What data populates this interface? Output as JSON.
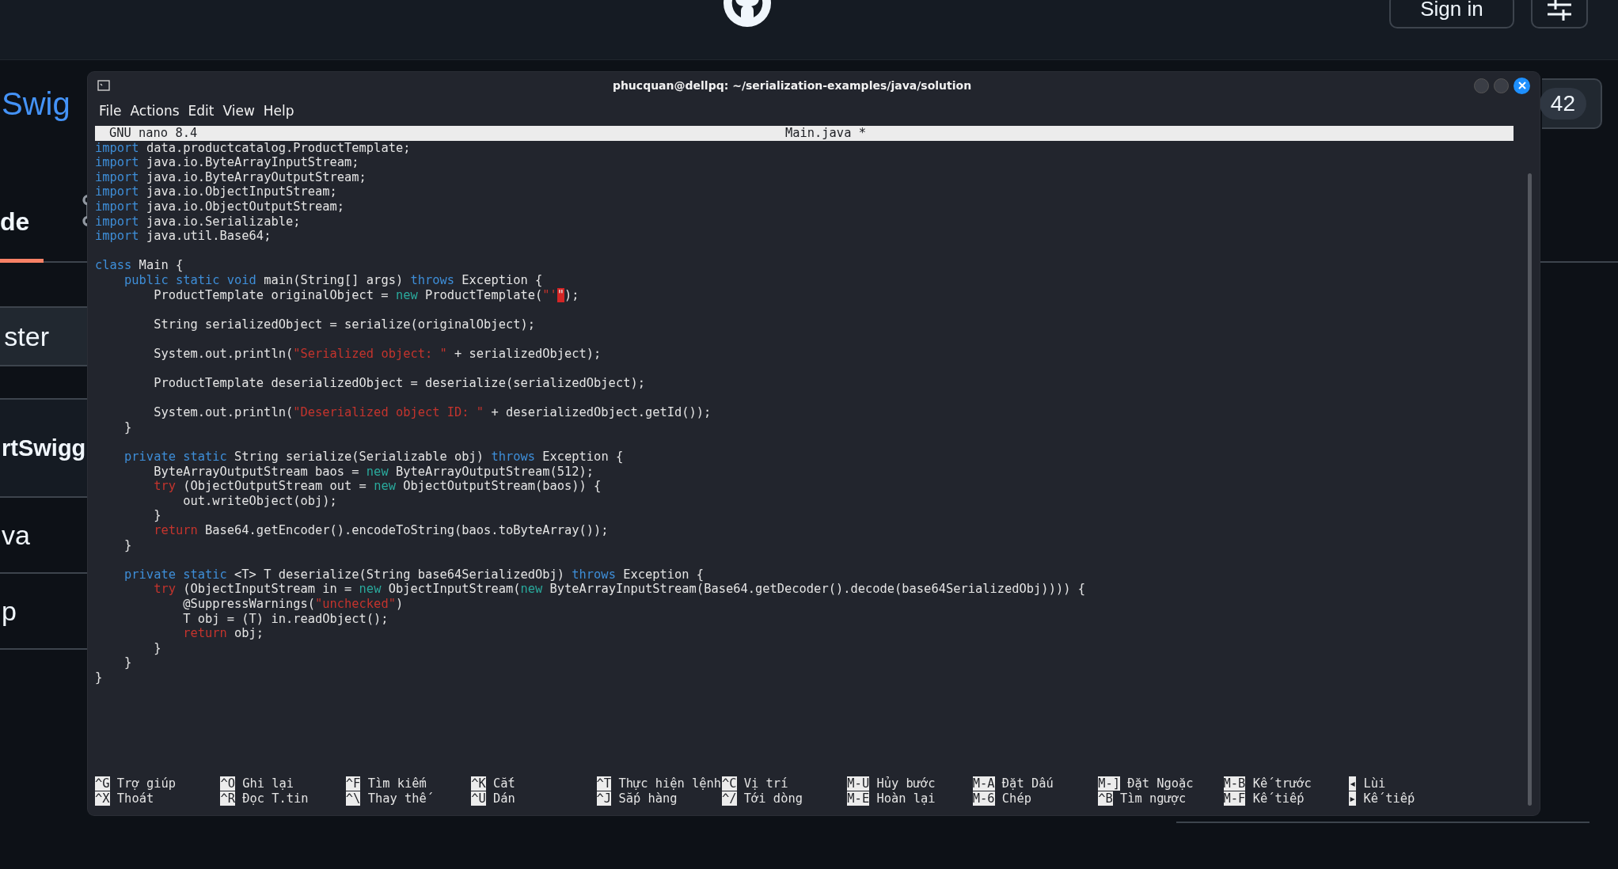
{
  "github": {
    "header": {
      "sign_in": "Sign in"
    },
    "repo": {
      "title": "Swig",
      "star_count": "42"
    },
    "tabs": [
      {
        "label": "de",
        "selected": true
      }
    ],
    "branch": "ster",
    "commit": {
      "author": "rtSwigg"
    },
    "files": [
      {
        "name": "va"
      },
      {
        "name": "p"
      }
    ]
  },
  "terminal": {
    "title": "phucquan@dellpq: ~/serialization-examples/java/solution",
    "menu": [
      "File",
      "Actions",
      "Edit",
      "View",
      "Help"
    ],
    "nano": {
      "version": "GNU nano 8.4",
      "filename": "Main.java *",
      "lines": [
        {
          "kind": "code",
          "segments": [
            {
              "kind": "keyword",
              "text": "import"
            },
            {
              "kind": "plain",
              "text": " data.productcatalog.ProductTemplate;"
            }
          ]
        },
        {
          "kind": "code",
          "segments": [
            {
              "kind": "keyword",
              "text": "import"
            },
            {
              "kind": "plain",
              "text": " java.io.ByteArrayInputStream;"
            }
          ]
        },
        {
          "kind": "code",
          "segments": [
            {
              "kind": "keyword",
              "text": "import"
            },
            {
              "kind": "plain",
              "text": " java.io.ByteArrayOutputStream;"
            }
          ]
        },
        {
          "kind": "code",
          "segments": [
            {
              "kind": "keyword",
              "text": "import"
            },
            {
              "kind": "plain",
              "text": " java.io.ObjectInputStream;"
            }
          ]
        },
        {
          "kind": "code",
          "segments": [
            {
              "kind": "keyword",
              "text": "import"
            },
            {
              "kind": "plain",
              "text": " java.io.ObjectOutputStream;"
            }
          ]
        },
        {
          "kind": "code",
          "segments": [
            {
              "kind": "keyword",
              "text": "import"
            },
            {
              "kind": "plain",
              "text": " java.io.Serializable;"
            }
          ]
        },
        {
          "kind": "code",
          "segments": [
            {
              "kind": "keyword",
              "text": "import"
            },
            {
              "kind": "plain",
              "text": " java.util.Base64;"
            }
          ]
        },
        {
          "kind": "blank"
        },
        {
          "kind": "code",
          "segments": [
            {
              "kind": "keyword",
              "text": "class"
            },
            {
              "kind": "plain",
              "text": " Main {"
            }
          ]
        },
        {
          "kind": "code",
          "segments": [
            {
              "kind": "keyword",
              "text": "    public static void"
            },
            {
              "kind": "plain",
              "text": " main(String[] args) "
            },
            {
              "kind": "keyword",
              "text": "throws"
            },
            {
              "kind": "plain",
              "text": " Exception {"
            }
          ]
        },
        {
          "kind": "code",
          "segments": [
            {
              "kind": "plain",
              "text": "        ProductTemplate originalObject = "
            },
            {
              "kind": "new",
              "text": "new"
            },
            {
              "kind": "plain",
              "text": " ProductTemplate("
            },
            {
              "kind": "string",
              "text": "\"'"
            },
            {
              "kind": "cursor",
              "text": "\""
            },
            {
              "kind": "plain",
              "text": ");"
            }
          ]
        },
        {
          "kind": "blank"
        },
        {
          "kind": "code",
          "segments": [
            {
              "kind": "plain",
              "text": "        String serializedObject = serialize(originalObject);"
            }
          ]
        },
        {
          "kind": "blank"
        },
        {
          "kind": "code",
          "segments": [
            {
              "kind": "plain",
              "text": "        System.out.println("
            },
            {
              "kind": "string",
              "text": "\"Serialized object: \""
            },
            {
              "kind": "plain",
              "text": " + serializedObject);"
            }
          ]
        },
        {
          "kind": "blank"
        },
        {
          "kind": "code",
          "segments": [
            {
              "kind": "plain",
              "text": "        ProductTemplate deserializedObject = deserialize(serializedObject);"
            }
          ]
        },
        {
          "kind": "blank"
        },
        {
          "kind": "code",
          "segments": [
            {
              "kind": "plain",
              "text": "        System.out.println("
            },
            {
              "kind": "string",
              "text": "\"Deserialized object ID: \""
            },
            {
              "kind": "plain",
              "text": " + deserializedObject.getId());"
            }
          ]
        },
        {
          "kind": "code",
          "segments": [
            {
              "kind": "plain",
              "text": "    }"
            }
          ]
        },
        {
          "kind": "blank"
        },
        {
          "kind": "code",
          "segments": [
            {
              "kind": "keyword",
              "text": "    private static"
            },
            {
              "kind": "plain",
              "text": " String serialize(Serializable obj) "
            },
            {
              "kind": "keyword",
              "text": "throws"
            },
            {
              "kind": "plain",
              "text": " Exception {"
            }
          ]
        },
        {
          "kind": "code",
          "segments": [
            {
              "kind": "plain",
              "text": "        ByteArrayOutputStream baos = "
            },
            {
              "kind": "new",
              "text": "new"
            },
            {
              "kind": "plain",
              "text": " ByteArrayOutputStream(512);"
            }
          ]
        },
        {
          "kind": "code",
          "segments": [
            {
              "kind": "control",
              "text": "        try"
            },
            {
              "kind": "plain",
              "text": " (ObjectOutputStream out = "
            },
            {
              "kind": "new",
              "text": "new"
            },
            {
              "kind": "plain",
              "text": " ObjectOutputStream(baos)) {"
            }
          ]
        },
        {
          "kind": "code",
          "segments": [
            {
              "kind": "plain",
              "text": "            out.writeObject(obj);"
            }
          ]
        },
        {
          "kind": "code",
          "segments": [
            {
              "kind": "plain",
              "text": "        }"
            }
          ]
        },
        {
          "kind": "code",
          "segments": [
            {
              "kind": "control",
              "text": "        return"
            },
            {
              "kind": "plain",
              "text": " Base64.getEncoder().encodeToString(baos.toByteArray());"
            }
          ]
        },
        {
          "kind": "code",
          "segments": [
            {
              "kind": "plain",
              "text": "    }"
            }
          ]
        },
        {
          "kind": "blank"
        },
        {
          "kind": "code",
          "segments": [
            {
              "kind": "keyword",
              "text": "    private static"
            },
            {
              "kind": "plain",
              "text": " <T> T deserialize(String base64SerializedObj) "
            },
            {
              "kind": "keyword",
              "text": "throws"
            },
            {
              "kind": "plain",
              "text": " Exception {"
            }
          ]
        },
        {
          "kind": "code",
          "segments": [
            {
              "kind": "control",
              "text": "        try"
            },
            {
              "kind": "plain",
              "text": " (ObjectInputStream in = "
            },
            {
              "kind": "new",
              "text": "new"
            },
            {
              "kind": "plain",
              "text": " ObjectInputStream("
            },
            {
              "kind": "new",
              "text": "new"
            },
            {
              "kind": "plain",
              "text": " ByteArrayInputStream(Base64.getDecoder().decode(base64SerializedObj)))) {"
            }
          ]
        },
        {
          "kind": "code",
          "segments": [
            {
              "kind": "plain",
              "text": "            @SuppressWarnings("
            },
            {
              "kind": "string",
              "text": "\"unchecked\""
            },
            {
              "kind": "plain",
              "text": ")"
            }
          ]
        },
        {
          "kind": "code",
          "segments": [
            {
              "kind": "plain",
              "text": "            T obj = (T) in.readObject();"
            }
          ]
        },
        {
          "kind": "code",
          "segments": [
            {
              "kind": "control",
              "text": "            return"
            },
            {
              "kind": "plain",
              "text": " obj;"
            }
          ]
        },
        {
          "kind": "code",
          "segments": [
            {
              "kind": "plain",
              "text": "        }"
            }
          ]
        },
        {
          "kind": "code",
          "segments": [
            {
              "kind": "plain",
              "text": "    }"
            }
          ]
        },
        {
          "kind": "code",
          "segments": [
            {
              "kind": "plain",
              "text": "}"
            }
          ]
        }
      ],
      "shortcuts": [
        [
          {
            "key": "^G",
            "label": "Trợ giúp"
          },
          {
            "key": "^X",
            "label": "Thoát"
          }
        ],
        [
          {
            "key": "^O",
            "label": "Ghi lại"
          },
          {
            "key": "^R",
            "label": "Đọc T.tin"
          }
        ],
        [
          {
            "key": "^F",
            "label": "Tìm kiếm"
          },
          {
            "key": "^\\",
            "label": "Thay thế"
          }
        ],
        [
          {
            "key": "^K",
            "label": "Cắt"
          },
          {
            "key": "^U",
            "label": "Dán"
          }
        ],
        [
          {
            "key": "^T",
            "label": "Thực hiện lệnh"
          },
          {
            "key": "^J",
            "label": "Sắp hàng"
          }
        ],
        [
          {
            "key": "^C",
            "label": "Vị trí"
          },
          {
            "key": "^/",
            "label": "Tới dòng"
          }
        ],
        [
          {
            "key": "M-U",
            "label": "Hủy bước"
          },
          {
            "key": "M-E",
            "label": "Hoàn lại"
          }
        ],
        [
          {
            "key": "M-A",
            "label": "Đặt Dấu"
          },
          {
            "key": "M-6",
            "label": "Chép"
          }
        ],
        [
          {
            "key": "M-]",
            "label": "Đặt Ngoặc"
          },
          {
            "key": "^B",
            "label": "Tìm ngược"
          }
        ],
        [
          {
            "key": "M-B",
            "label": "Kế trước"
          },
          {
            "key": "M-F",
            "label": "Kế tiếp"
          }
        ],
        [
          {
            "key": "◂",
            "label": "Lùi"
          },
          {
            "key": "▸",
            "label": "Kế tiếp"
          }
        ]
      ]
    }
  }
}
